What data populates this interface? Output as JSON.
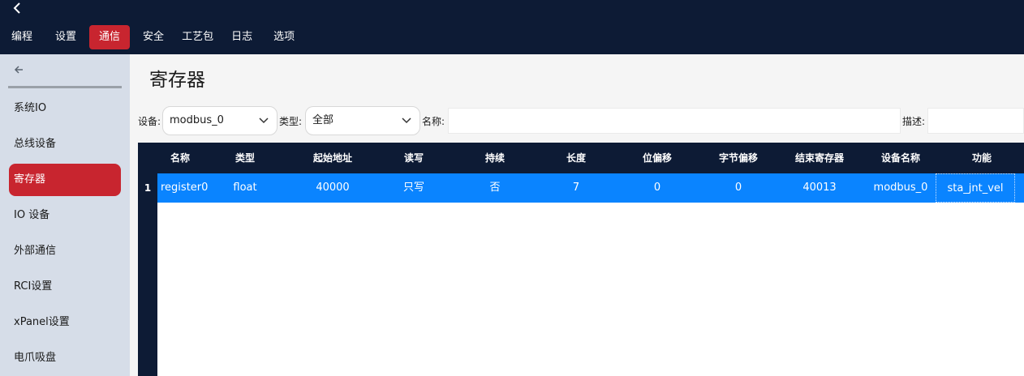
{
  "topbar": {
    "back_icon": "chevron-left-icon",
    "menu": [
      "编程",
      "设置",
      "通信",
      "安全",
      "工艺包",
      "日志",
      "选项"
    ],
    "active_menu": "通信"
  },
  "sidebar": {
    "back_icon": "arrow-left-icon",
    "items": [
      "系统IO",
      "总线设备",
      "寄存器",
      "IO 设备",
      "外部通信",
      "RCI设置",
      "xPanel设置",
      "电爪吸盘"
    ],
    "active_item": "寄存器"
  },
  "page": {
    "title": "寄存器"
  },
  "filters": {
    "device_label": "设备:",
    "device_value": "modbus_0",
    "type_label": "类型:",
    "type_value": "全部",
    "name_label": "名称:",
    "name_value": "",
    "desc_label": "描述:",
    "desc_value": ""
  },
  "table": {
    "columns": [
      "名称",
      "类型",
      "起始地址",
      "读写",
      "持续",
      "长度",
      "位偏移",
      "字节偏移",
      "结束寄存器",
      "设备名称",
      "功能"
    ],
    "rows": [
      {
        "num": "1",
        "cells": [
          "register0",
          "float",
          "40000",
          "只写",
          "否",
          "7",
          "0",
          "0",
          "40013",
          "modbus_0",
          "sta_jnt_vel"
        ]
      }
    ]
  },
  "colors": {
    "header_bg": "#0d1b35",
    "accent_red": "#c8252f",
    "selected_row": "#0a84ff",
    "sidebar_bg": "#d6dde8"
  }
}
